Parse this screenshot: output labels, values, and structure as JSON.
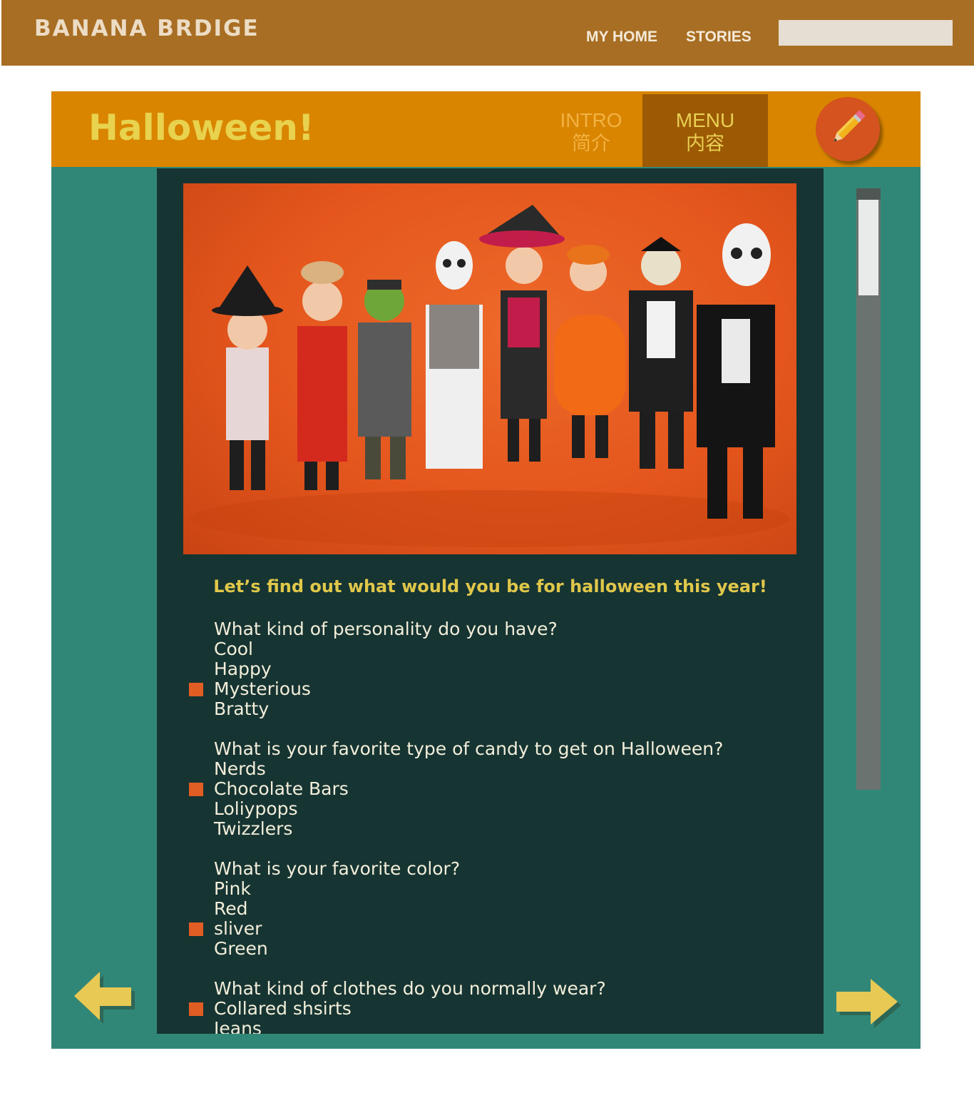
{
  "header": {
    "brand": "BANANA BRDIGE",
    "nav": {
      "home": "MY HOME",
      "stories": "STORIES"
    },
    "search": {
      "value": "",
      "placeholder": ""
    }
  },
  "page": {
    "title": "Halloween!",
    "tabs": {
      "intro": {
        "en": "INTRO",
        "zh": "简介"
      },
      "menu": {
        "en": "MENU",
        "zh": "内容"
      }
    },
    "active_tab": "menu",
    "edit_icon": "pencil-icon"
  },
  "content": {
    "intro": "Let’s find out what would you be for halloween this year!",
    "questions": [
      {
        "text": "What kind of personality do you have?",
        "options": [
          "Cool",
          "Happy",
          "Mysterious",
          "Bratty"
        ],
        "selected": 2
      },
      {
        "text": "What is your favorite type of candy to get on Halloween?",
        "options": [
          "Nerds",
          "Chocolate Bars",
          "Loliypops",
          "Twizzlers"
        ],
        "selected": 1
      },
      {
        "text": "What is your favorite color?",
        "options": [
          "Pink",
          "Red",
          "sliver",
          "Green"
        ],
        "selected": 2
      },
      {
        "text": "What kind of clothes do you normally wear?",
        "options": [
          "Collared shsirts",
          "Jeans"
        ],
        "selected": 0
      }
    ]
  },
  "colors": {
    "topbar": "#a86e24",
    "header": "#d98500",
    "active_tab": "#9c5a04",
    "panel": "#318777",
    "content": "#163432",
    "accent": "#e0c74a",
    "marker": "#e05d24"
  },
  "icons": {
    "prev": "arrow-left-icon",
    "next": "arrow-right-icon",
    "edit": "pencil-icon"
  }
}
